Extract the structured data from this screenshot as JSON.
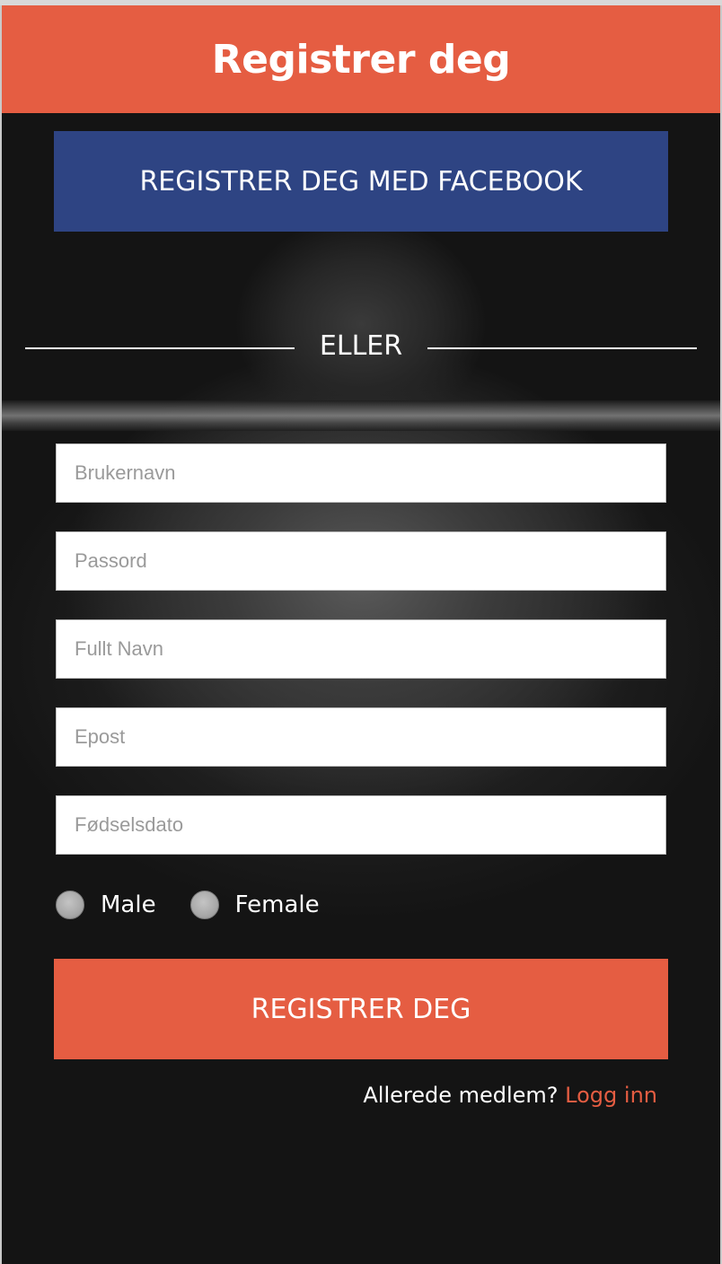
{
  "header": {
    "title": "Registrer deg"
  },
  "facebook_button": {
    "label": "REGISTRER DEG MED FACEBOOK",
    "color": "#2e4483"
  },
  "divider": {
    "text": "ELLER"
  },
  "form": {
    "username_placeholder": "Brukernavn",
    "password_placeholder": "Passord",
    "fullname_placeholder": "Fullt Navn",
    "email_placeholder": "Epost",
    "birthdate_placeholder": "Fødselsdato",
    "gender_options": [
      "Male",
      "Female"
    ]
  },
  "submit_button": {
    "label": "REGISTRER DEG",
    "color": "#e55d42"
  },
  "login_prompt": {
    "text": "Allerede medlem? ",
    "link_label": "Logg inn"
  },
  "colors": {
    "accent": "#e55d42",
    "background": "#141414"
  }
}
